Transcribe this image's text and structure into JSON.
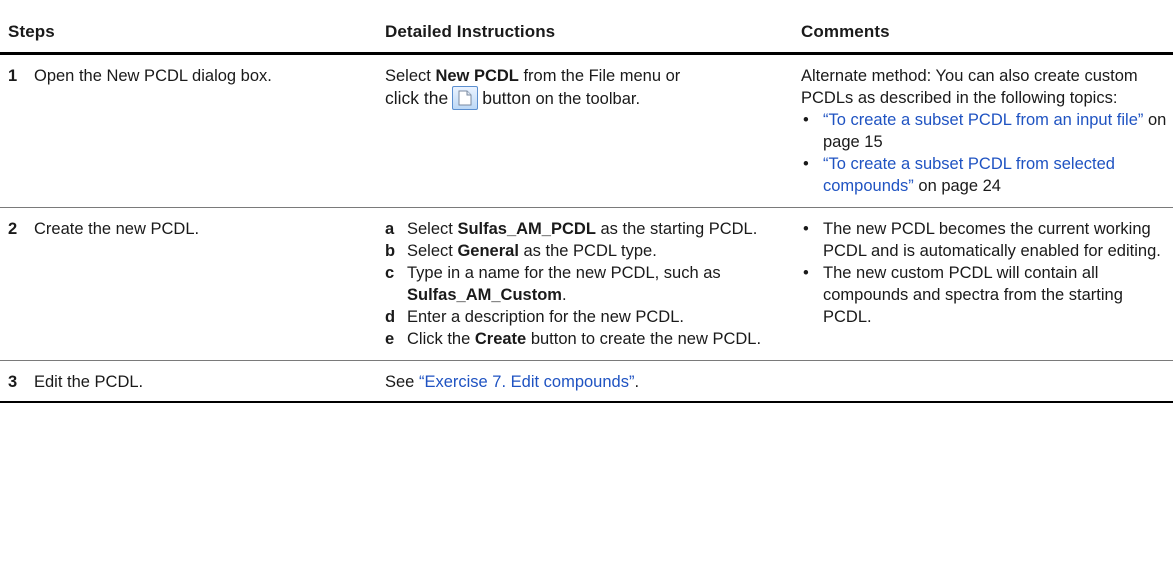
{
  "headers": {
    "steps": "Steps",
    "instructions": "Detailed Instructions",
    "comments": "Comments"
  },
  "rows": [
    {
      "num": "1",
      "step": "Open the New PCDL dialog box.",
      "instr": {
        "pre": "Select ",
        "bold": "New PCDL",
        "mid": " from the File menu or",
        "line2_pre": "click the",
        "line2_post": "button",
        "line2_tail": " on the toolbar."
      },
      "comment": {
        "intro": "Alternate method: You can also create custom PCDLs as described in the following topics:",
        "links": [
          {
            "text": "“To create a subset PCDL from an input file”",
            "page": " on page 15"
          },
          {
            "text": "“To create a subset PCDL from selected compounds”",
            "page": " on page 24"
          }
        ]
      }
    },
    {
      "num": "2",
      "step": "Create the new PCDL.",
      "substeps": [
        {
          "marker": "a",
          "pre": "Select ",
          "bold": "Sulfas_AM_PCDL",
          "post": " as the starting PCDL."
        },
        {
          "marker": "b",
          "pre": "Select ",
          "bold": "General",
          "post": " as the PCDL type."
        },
        {
          "marker": "c",
          "pre": "Type in a name for the new PCDL, such as ",
          "bold": "Sulfas_AM_Custom",
          "post": "."
        },
        {
          "marker": "d",
          "pre": "Enter a description for the new PCDL.",
          "bold": "",
          "post": ""
        },
        {
          "marker": "e",
          "pre": "Click the ",
          "bold": "Create",
          "post": " button to create the new PCDL."
        }
      ],
      "comments": [
        "The new PCDL becomes the current working PCDL and is automatically enabled for editing.",
        "The new custom PCDL will contain all compounds and spectra from the starting PCDL."
      ]
    },
    {
      "num": "3",
      "step": "Edit the PCDL.",
      "instr": {
        "pre": "See ",
        "link": "“Exercise 7. Edit compounds”",
        "post": "."
      }
    }
  ],
  "icons": {
    "toolbar_button": "new-document-icon"
  },
  "colors": {
    "link": "#1f53c2"
  }
}
